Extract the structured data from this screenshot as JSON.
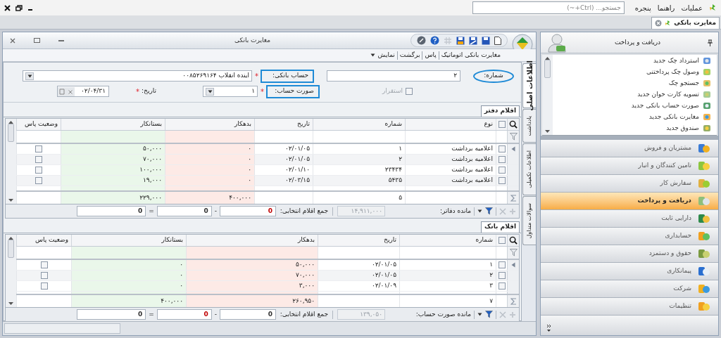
{
  "menu_bar": {
    "items": [
      "عملیات",
      "راهنما",
      "پنجره"
    ],
    "search": {
      "placeholder": "جستجو... (Ctrl+~)"
    }
  },
  "tabs": [
    {
      "label": "مغایرت بانکی",
      "selected": true
    }
  ],
  "document": {
    "title": "مغایرت بانکی",
    "menu": [
      {
        "label": "مغایرت بانکی اتوماتیک",
        "dropdown": false
      },
      {
        "label": "پاس",
        "dropdown": false
      },
      {
        "label": "برگشت",
        "dropdown": false
      },
      {
        "label": "نمایش",
        "dropdown": true
      }
    ],
    "form": {
      "number": {
        "label": "شماره:",
        "value": "۲",
        "highlighted": true
      },
      "posted": {
        "label": "استقرار",
        "checked": false,
        "disabled": true
      },
      "bank_account": {
        "label": "حساب بانکی:",
        "required_mark": "*",
        "value": "اینده انقلاب ۰۰۸۵۲۶۹۱۶۴",
        "highlighted": true
      },
      "statement": {
        "label": "صورت حساب:",
        "required_mark": "*",
        "value": "۱",
        "highlighted": true
      },
      "date": {
        "label": "تاریخ:",
        "required_mark": "*",
        "value": "۰۲/۰۴/۳۱"
      }
    },
    "vertical_tabs": [
      {
        "label": "اطلاعات اصلی",
        "selected": true
      },
      {
        "label": "یادداشت",
        "selected": false
      },
      {
        "label": "اطلاعات تکمیلی",
        "selected": false
      },
      {
        "label": "سوالات متداول",
        "selected": false
      }
    ],
    "grids": [
      {
        "title": "اقلام دفتر",
        "all_checked": false,
        "columns": [
          {
            "title": "نوع",
            "kind": "text",
            "summed": false
          },
          {
            "title": "شماره",
            "kind": "text",
            "summed": true
          },
          {
            "title": "تاریخ",
            "kind": "date",
            "summed": false
          },
          {
            "title": "بدهکار",
            "kind": "debit",
            "summed": true
          },
          {
            "title": "بستانکار",
            "kind": "credit",
            "summed": true
          },
          {
            "title": "وضعیت پاس",
            "kind": "pass",
            "summed": false
          }
        ],
        "rows": [
          {
            "selected": true,
            "checked": false,
            "cells": [
              "اعلامیه برداشت",
              "۱",
              "۰۲/۰۱/۰۵",
              "۰",
              "۵۰,۰۰۰"
            ],
            "passed": false
          },
          {
            "selected": false,
            "checked": false,
            "cells": [
              "اعلامیه برداشت",
              "۲",
              "۰۲/۰۱/۰۵",
              "۰",
              "۷۰,۰۰۰"
            ],
            "passed": false
          },
          {
            "selected": false,
            "checked": false,
            "cells": [
              "اعلامیه برداشت",
              "۲۳۴۳۴",
              "۰۲/۰۱/۱۰",
              "۰",
              "۱۰۰,۰۰۰"
            ],
            "passed": false
          },
          {
            "selected": false,
            "checked": false,
            "cells": [
              "اعلامیه برداشت",
              "۵۴۳۵",
              "۰۲/۰۳/۱۵",
              "۰",
              "۱۹,۰۰۰"
            ],
            "passed": false
          }
        ],
        "totals": [
          "۵",
          "۴۰۰,۰۰۰",
          "۲۲۹,۰۰۰"
        ],
        "footer": {
          "balance_label": "مانده دفاتر:",
          "balance_value": "۱۴,۹۱۱,۰۰۰",
          "selection_label": "جمع اقلام انتخابی:",
          "sums": [
            {
              "text": "0",
              "color": "#c00000"
            },
            {
              "text": "0",
              "color": "#333333"
            },
            {
              "text": "0",
              "color": "#333333"
            }
          ],
          "operators": [
            "-",
            "="
          ]
        }
      },
      {
        "title": "اقلام بانک",
        "all_checked": false,
        "columns": [
          {
            "title": "شماره",
            "kind": "text",
            "summed": true
          },
          {
            "title": "تاریخ",
            "kind": "date",
            "summed": false
          },
          {
            "title": "بدهکار",
            "kind": "debit",
            "summed": true
          },
          {
            "title": "بستانکار",
            "kind": "credit",
            "summed": true
          },
          {
            "title": "وضعیت پاس",
            "kind": "pass",
            "summed": false
          }
        ],
        "rows": [
          {
            "selected": true,
            "checked": false,
            "cells": [
              "۱",
              "۰۲/۰۱/۰۵",
              "۵۰,۰۰۰",
              "۰"
            ],
            "passed": false
          },
          {
            "selected": false,
            "checked": false,
            "cells": [
              "۲",
              "۰۲/۰۱/۰۵",
              "۷۰,۰۰۰",
              "۰"
            ],
            "passed": false
          },
          {
            "selected": false,
            "checked": false,
            "cells": [
              "۳",
              "۰۲/۰۱/۰۹",
              "۳,۰۰۰",
              "۰"
            ],
            "passed": false
          }
        ],
        "totals": [
          "۷",
          "۲۶۰,۹۵۰",
          "۴۰۰,۰۰۰"
        ],
        "footer": {
          "balance_label": "مانده صورت حساب:",
          "balance_value": "۱۳۹,۰۵۰",
          "selection_label": "جمع اقلام انتخابی:",
          "sums": [
            {
              "text": "0",
              "color": "#333333"
            },
            {
              "text": "0",
              "color": "#c00000"
            },
            {
              "text": "0",
              "color": "#333333"
            }
          ],
          "operators": [
            "-",
            "="
          ]
        }
      }
    ]
  },
  "sidebar": {
    "header": "دریافت و پرداخت",
    "tasks": [
      "استرداد چک جدید",
      "وصول چک پرداختنی",
      "جستجو چک",
      "تسویه کارت خوان جدید",
      "صورت حساب بانکی جدید",
      "مغایرت بانکی جدید",
      "صندوق جدید"
    ],
    "modules": [
      {
        "label": "مشتریان و فروش",
        "selected": false
      },
      {
        "label": "تامین کنندگان و انبار",
        "selected": false
      },
      {
        "label": "سفارش کار",
        "selected": false
      },
      {
        "label": "دریافت و پرداخت",
        "selected": true
      },
      {
        "label": "دارایی ثابت",
        "selected": false
      },
      {
        "label": "حسابداری",
        "selected": false
      },
      {
        "label": "حقوق و دستمزد",
        "selected": false
      },
      {
        "label": "پیمانکاری",
        "selected": false
      },
      {
        "label": "شرکت",
        "selected": false
      },
      {
        "label": "تنظیمات",
        "selected": false
      }
    ]
  }
}
